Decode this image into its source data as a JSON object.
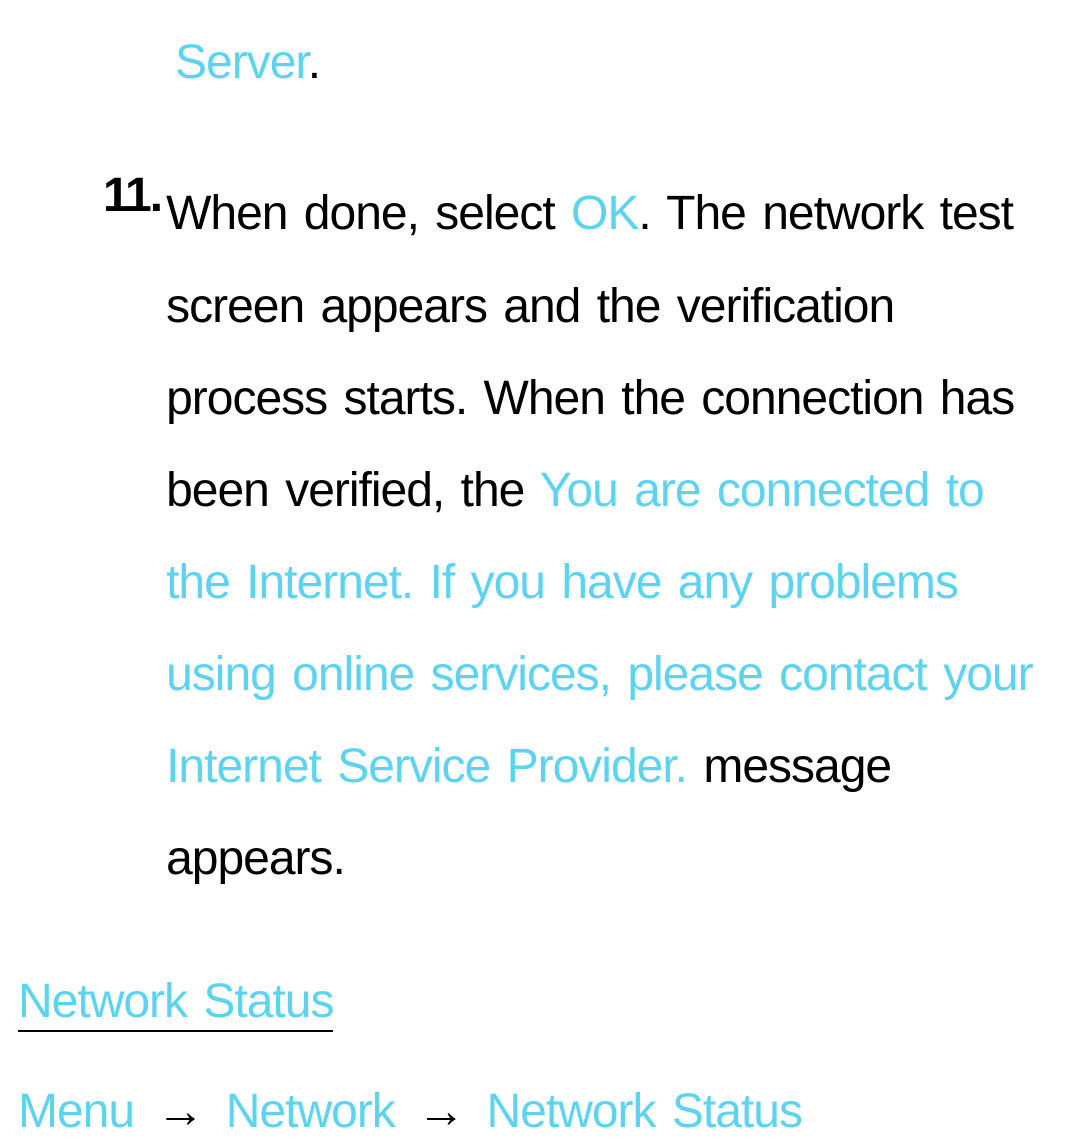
{
  "fragment": {
    "server": "Server",
    "period": "."
  },
  "step": {
    "number": "11.",
    "text_part1": "When done, select ",
    "ok": "OK",
    "text_part2": ". The network test screen appears and the verification process starts. When the ",
    "text_part2b": "connection has been verified, the ",
    "message": "You are connected to the Internet. If you have any problems using online services, please contact your Internet Service Provider.",
    "text_part3": " message appears."
  },
  "section": {
    "header": "Network Status"
  },
  "breadcrumb": {
    "menu": "Menu",
    "arrow": "→",
    "network": "Network",
    "network_status": "Network Status"
  }
}
